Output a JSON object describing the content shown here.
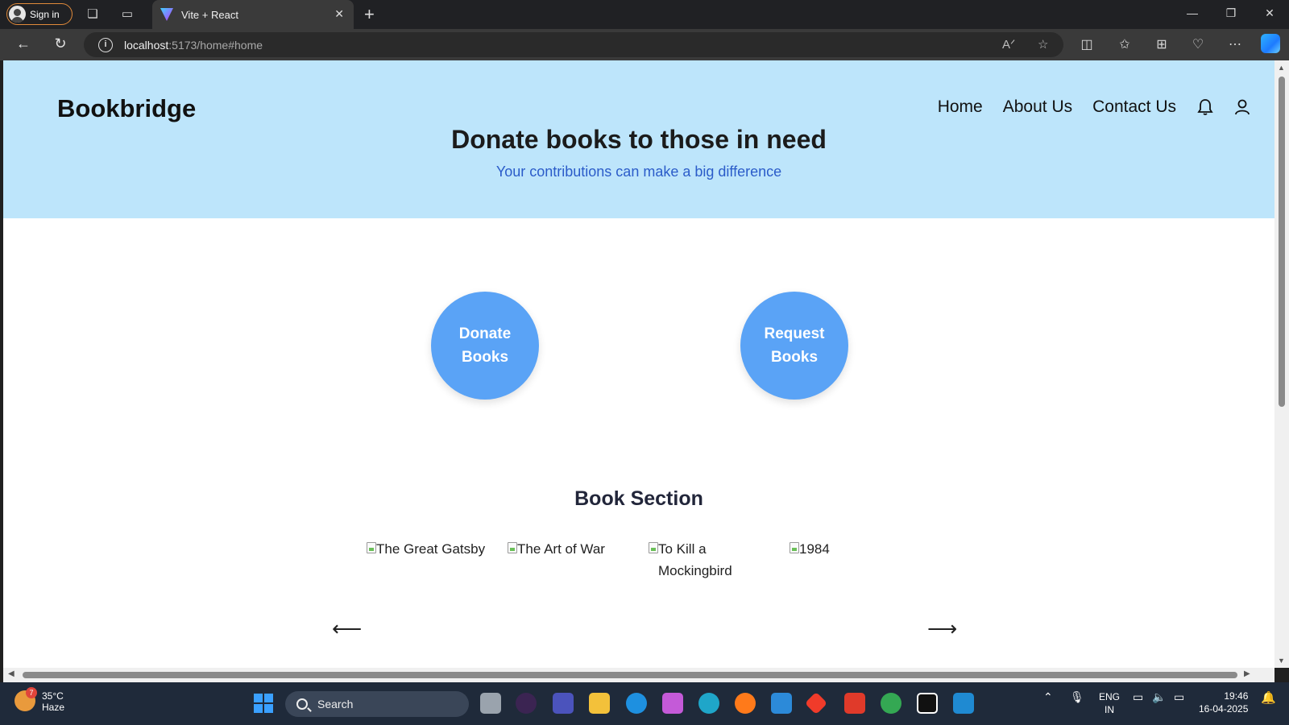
{
  "browser": {
    "signin_label": "Sign in",
    "tab_title": "Vite + React",
    "tab_close": "✕",
    "new_tab": "+",
    "url_host": "localhost",
    "url_path": ":5173/home#home"
  },
  "site": {
    "brand": "Bookbridge",
    "nav": [
      "Home",
      "About Us",
      "Contact Us"
    ],
    "hero_title": "Donate books to those in need",
    "hero_subtitle": "Your contributions can make a big difference",
    "donate_label": "Donate Books",
    "request_label": "Request Books",
    "section_title": "Book Section",
    "books": [
      "The Great Gatsby",
      "The Art of War",
      "To Kill a Mockingbird",
      "1984"
    ],
    "prev_arrow": "⟵",
    "next_arrow": "⟶"
  },
  "taskbar": {
    "temperature": "35°C",
    "weather": "Haze",
    "weather_badge": "7",
    "search_label": "Search",
    "lang": "ENG",
    "region": "IN",
    "time": "19:46",
    "date": "16-04-2025"
  },
  "colors": {
    "hero_bg": "#bde5fb",
    "button_blue": "#5aa3f6",
    "subtitle_blue": "#2b5cc9"
  }
}
